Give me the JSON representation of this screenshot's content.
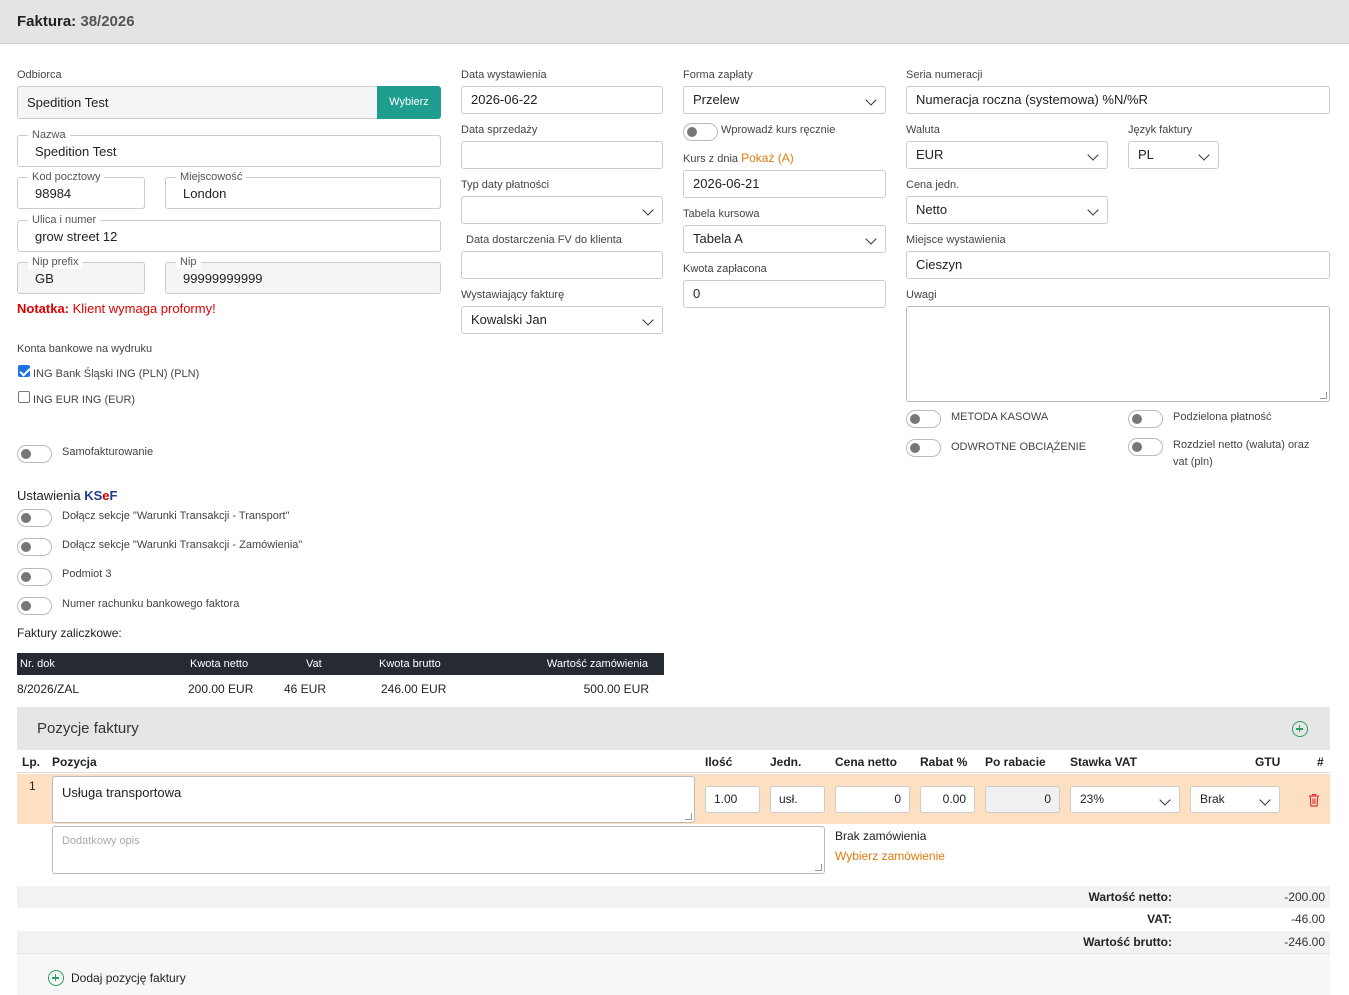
{
  "header": {
    "label": "Faktura:",
    "number": "38/2026"
  },
  "odbiorca": {
    "label": "Odbiorca",
    "value": "Spedition Test",
    "button": "Wybierz",
    "nazwa_label": "Nazwa",
    "nazwa": "Spedition Test",
    "kod_label": "Kod pocztowy",
    "kod": "98984",
    "miejscowosc_label": "Miejscowość",
    "miejscowosc": "London",
    "ulica_label": "Ulica i numer",
    "ulica": "grow street 12",
    "nip_prefix_label": "Nip prefix",
    "nip_prefix": "GB",
    "nip_label": "Nip",
    "nip": "99999999999",
    "notatka_label": "Notatka:",
    "notatka": "Klient wymaga proformy!"
  },
  "konta": {
    "label": "Konta bankowe na wydruku",
    "items": [
      {
        "label": "ING Bank Śląski ING (PLN) (PLN)",
        "checked": true
      },
      {
        "label": "ING EUR ING (EUR)",
        "checked": false
      }
    ]
  },
  "samofakturowanie": "Samofakturowanie",
  "ksef": {
    "label": "Ustawienia",
    "k": "K",
    "s": "S",
    "e": "e",
    "f": "F",
    "toggles": [
      "Dołącz sekcje \"Warunki Transakcji - Transport\"",
      "Dołącz sekcje \"Warunki Transakcji - Zamówienia\"",
      "Podmiot 3",
      "Numer rachunku bankowego faktora"
    ]
  },
  "zaliczkowe": {
    "label": "Faktury zaliczkowe:",
    "columns": [
      "Nr. dok",
      "Kwota netto",
      "Vat",
      "Kwota brutto",
      "Wartość zamówienia"
    ],
    "rows": [
      [
        "8/2026/ZAL",
        "200.00 EUR",
        "46 EUR",
        "246.00 EUR",
        "500.00 EUR"
      ]
    ]
  },
  "col2": {
    "data_wyst_label": "Data wystawienia",
    "data_wyst": "2026-06-22",
    "data_sprz_label": "Data sprzedaży",
    "data_sprz": "",
    "typ_daty_label": "Typ daty płatności",
    "typ_daty": "",
    "data_dost_label": "Data dostarczenia FV do klienta",
    "data_dost": "",
    "wystawiajacy_label": "Wystawiający fakturę",
    "wystawiajacy": "Kowalski Jan"
  },
  "col3": {
    "forma_label": "Forma zapłaty",
    "forma": "Przelew",
    "kurs_toggle": "Wprowadź kurs ręcznie",
    "kurs_label": "Kurs z dnia",
    "kurs_link": "Pokaż (A)",
    "kurs_date": "2026-06-21",
    "tabela_label": "Tabela kursowa",
    "tabela": "Tabela A",
    "kwota_label": "Kwota zapłacona",
    "kwota": "0"
  },
  "col4": {
    "seria_label": "Seria numeracji",
    "seria": "Numeracja roczna (systemowa) %N/%R",
    "waluta_label": "Waluta",
    "waluta": "EUR",
    "jezyk_label": "Język faktury",
    "jezyk": "PL",
    "cena_label": "Cena jedn.",
    "cena": "Netto",
    "miejsce_label": "Miejsce wystawienia",
    "miejsce": "Cieszyn",
    "uwagi_label": "Uwagi",
    "uwagi": "",
    "toggles": {
      "metoda": "METODA KASOWA",
      "podzielona": "Podzielona płatność",
      "odwrotne": "ODWROTNE OBCIĄŻENIE",
      "rozdziel_1": "Rozdziel netto (waluta) oraz",
      "rozdziel_2": "vat (pln)"
    }
  },
  "pozycje": {
    "title": "Pozycje faktury",
    "columns": {
      "lp": "Lp.",
      "pozycja": "Pozycja",
      "ilosc": "Ilość",
      "jedn": "Jedn.",
      "cena": "Cena netto",
      "rabat": "Rabat %",
      "po_rabacie": "Po rabacie",
      "stawka": "Stawka VAT",
      "gtu": "GTU",
      "hash": "#"
    },
    "row": {
      "lp": "1",
      "nazwa": "Usługa transportowa",
      "ilosc": "1.00",
      "jedn": "usł.",
      "cena": "0",
      "rabat": "0.00",
      "po_rabacie": "0",
      "stawka": "23%",
      "gtu": "Brak",
      "opis_placeholder": "Dodatkowy opis",
      "brak_zam": "Brak zamówienia",
      "wybierz_zam": "Wybierz zamówienie"
    },
    "totals": [
      {
        "label": "Wartość netto:",
        "value": "-200.00"
      },
      {
        "label": "VAT:",
        "value": "-46.00"
      },
      {
        "label": "Wartość brutto:",
        "value": "-246.00"
      }
    ],
    "add": "Dodaj pozycję faktury"
  },
  "colors": {
    "teal": "#1f9d8f",
    "orange_link": "#e07a10",
    "red_note": "#e00000",
    "ksef_blue": "#1c3f94",
    "ksef_red": "#d40000",
    "row_highlight": "#fde0c2",
    "green_plus": "#27a060"
  }
}
